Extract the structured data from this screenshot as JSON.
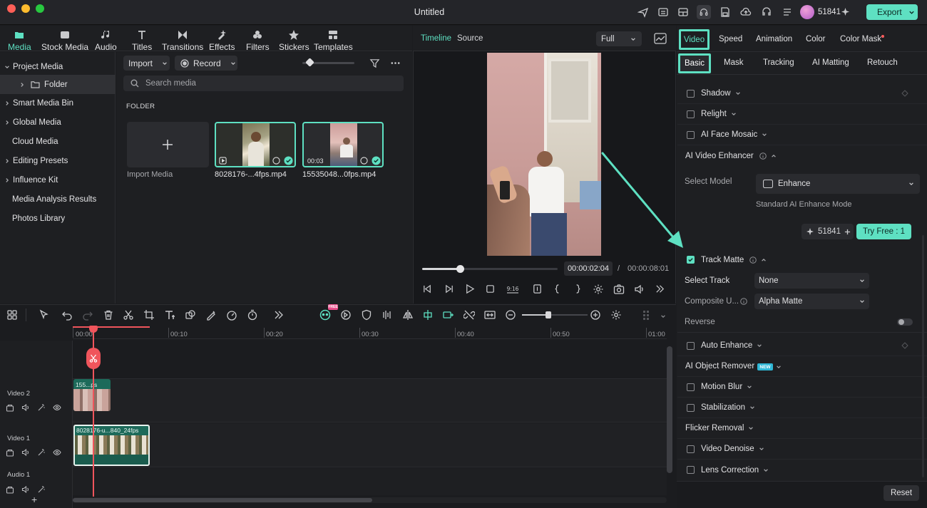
{
  "window": {
    "title": "Untitled",
    "credits": "51841",
    "export_label": "Export"
  },
  "left_tabs": [
    {
      "label": "Media",
      "icon": "media-icon"
    },
    {
      "label": "Stock Media",
      "icon": "stock-media-icon"
    },
    {
      "label": "Audio",
      "icon": "audio-icon"
    },
    {
      "label": "Titles",
      "icon": "titles-icon"
    },
    {
      "label": "Transitions",
      "icon": "transitions-icon"
    },
    {
      "label": "Effects",
      "icon": "effects-icon"
    },
    {
      "label": "Filters",
      "icon": "filters-icon"
    },
    {
      "label": "Stickers",
      "icon": "stickers-icon"
    },
    {
      "label": "Templates",
      "icon": "templates-icon"
    }
  ],
  "tree": [
    {
      "label": "Project Media",
      "expander": "down"
    },
    {
      "label": "Folder",
      "expander": "right"
    },
    {
      "label": "Smart Media Bin",
      "expander": "right"
    },
    {
      "label": "Global Media",
      "expander": "right"
    },
    {
      "label": "Cloud Media",
      "expander": "none"
    },
    {
      "label": "Editing Presets",
      "expander": "right"
    },
    {
      "label": "Influence Kit",
      "expander": "right"
    },
    {
      "label": "Media Analysis Results",
      "expander": "none"
    },
    {
      "label": "Photos Library",
      "expander": "none"
    }
  ],
  "media": {
    "import_label": "Import",
    "record_label": "Record",
    "search_placeholder": "Search media",
    "folder_heading": "FOLDER",
    "import_media_label": "Import Media",
    "items": [
      {
        "name": "8028176-...4fps.mp4",
        "duration": ""
      },
      {
        "name": "15535048...0fps.mp4",
        "duration": "00:03"
      }
    ]
  },
  "player": {
    "tab_timeline": "Timeline",
    "tab_source": "Source",
    "quality": "Full",
    "current_time": "00:00:02:04",
    "separator": "/",
    "total_time": "00:00:08:01",
    "progress": 0.28
  },
  "right_panel": {
    "tabs": [
      "Video",
      "Speed",
      "Animation",
      "Color",
      "Color Mask"
    ],
    "subtabs": [
      "Basic",
      "Mask",
      "Tracking",
      "AI Matting",
      "Retouch"
    ],
    "rows_top": [
      {
        "label": "Shadow",
        "checkbox": true
      },
      {
        "label": "Relight",
        "checkbox": true
      },
      {
        "label": "AI Face Mosaic",
        "checkbox": true
      }
    ],
    "enhancer_label": "AI Video Enhancer",
    "select_model_label": "Select Model",
    "model_value": "Enhance",
    "model_desc": "Standard AI Enhance Mode",
    "credits": "51841",
    "try_free": "Try Free : 1",
    "track_matte_label": "Track Matte",
    "select_track_label": "Select Track",
    "select_track_value": "None",
    "composite_label": "Composite U...",
    "composite_value": "Alpha Matte",
    "reverse_label": "Reverse",
    "rows_bottom": [
      {
        "label": "Auto Enhance",
        "checkbox": true
      },
      {
        "label": "AI Object Remover",
        "checkbox": false,
        "badge": "NEW"
      },
      {
        "label": "Motion Blur",
        "checkbox": true
      },
      {
        "label": "Stabilization",
        "checkbox": true
      },
      {
        "label": "Flicker Removal",
        "checkbox": false
      },
      {
        "label": "Video Denoise",
        "checkbox": true
      },
      {
        "label": "Lens Correction",
        "checkbox": true
      }
    ],
    "reset_label": "Reset"
  },
  "timeline": {
    "ruler": [
      "00:00",
      "00:10",
      "00:20",
      "00:30",
      "00:40",
      "00:50",
      "01:00"
    ],
    "tracks": [
      {
        "label": "Video 2",
        "clip": "155...ps"
      },
      {
        "label": "Video 1",
        "clip": "8028176-u...840_24fps"
      },
      {
        "label": "Audio 1",
        "clip": ""
      }
    ],
    "free_badge": "FREE",
    "add_track": "+"
  },
  "colors": {
    "accent": "#5ee0c2",
    "clip_green": "#1d6a5a",
    "playhead": "#f0555c"
  }
}
